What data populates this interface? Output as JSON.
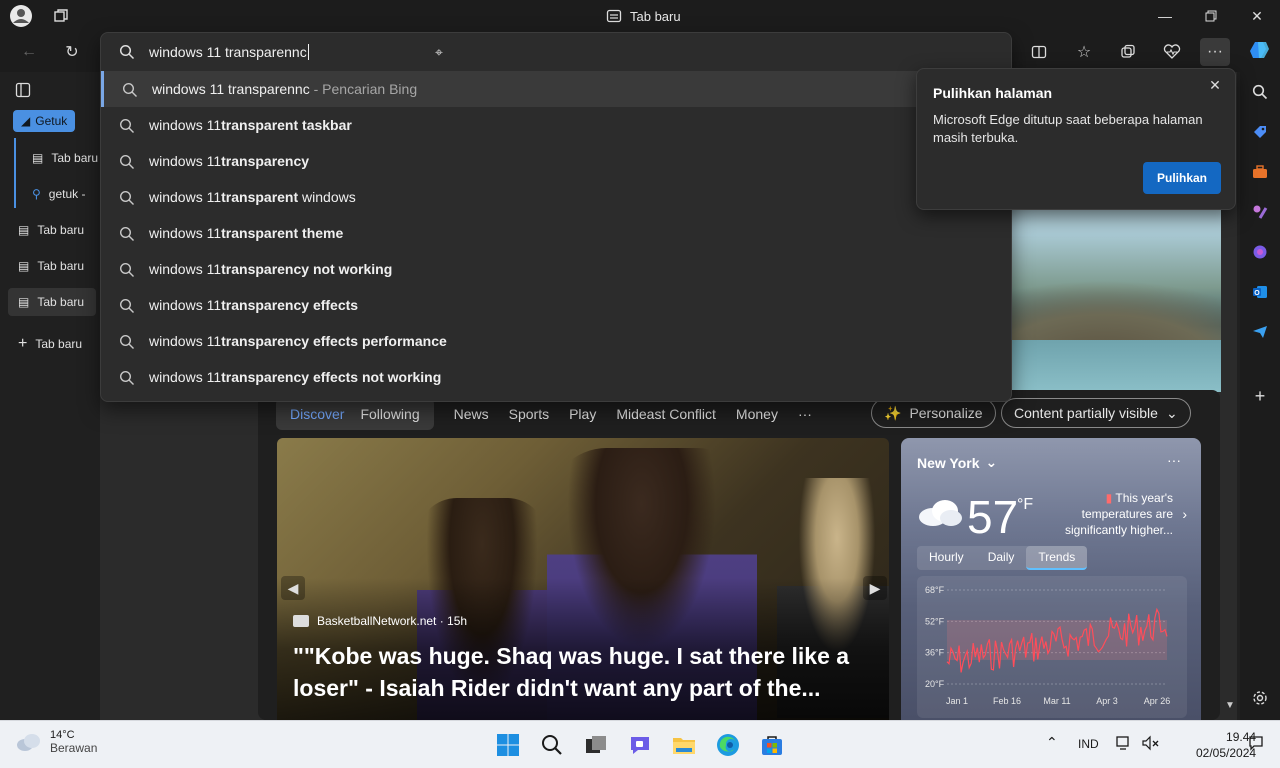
{
  "window": {
    "title": "Tab baru"
  },
  "omnibox": {
    "query": "windows 11 transparennc",
    "suggestions": [
      {
        "prefix": "windows 11 transparennc",
        "bold": "",
        "rest": "",
        "suffix": " - Pencarian Bing"
      },
      {
        "prefix": "windows 11 ",
        "bold": "transparent taskbar",
        "rest": "",
        "suffix": ""
      },
      {
        "prefix": "windows 11 ",
        "bold": "transparency",
        "rest": "",
        "suffix": ""
      },
      {
        "prefix": "windows 11 ",
        "bold": "transparent",
        "rest": " windows",
        "suffix": ""
      },
      {
        "prefix": "windows 11 ",
        "bold": "transparent theme",
        "rest": "",
        "suffix": ""
      },
      {
        "prefix": "windows 11 ",
        "bold": "transparency not working",
        "rest": "",
        "suffix": ""
      },
      {
        "prefix": "windows 11 ",
        "bold": "transparency effects",
        "rest": "",
        "suffix": ""
      },
      {
        "prefix": "windows 11 ",
        "bold": "transparency effects performance",
        "rest": "",
        "suffix": ""
      },
      {
        "prefix": "windows 11 ",
        "bold": "transparency effects not working",
        "rest": "",
        "suffix": ""
      }
    ]
  },
  "vertical_tabs": {
    "group_label": "Getuk",
    "group_items": [
      "Tab baru",
      "getuk -"
    ],
    "tabs": [
      "Tab baru",
      "Tab baru",
      "Tab baru"
    ],
    "new_tab_label": "Tab baru"
  },
  "popup": {
    "title": "Pulihkan halaman",
    "body": "Microsoft Edge ditutup saat beberapa halaman masih terbuka.",
    "button": "Pulihkan"
  },
  "feed": {
    "segment": [
      "Discover",
      "Following"
    ],
    "tabs": [
      "News",
      "Sports",
      "Play",
      "Mideast Conflict",
      "Money",
      "···"
    ],
    "personalize": "Personalize",
    "content_filter": "Content partially visible"
  },
  "news_card": {
    "source": "BasketballNetwork.net · 15h",
    "headline": "\"\"Kobe was huge. Shaq was huge. I sat there like a loser\" - Isaiah Rider didn't want any part of the..."
  },
  "weather": {
    "city": "New York",
    "temp": "57",
    "unit": "°F",
    "note": "This year's temperatures are significantly higher...",
    "tabs": [
      "Hourly",
      "Daily",
      "Trends"
    ],
    "chart_data": {
      "type": "line",
      "y_ticks": [
        "68°F",
        "52°F",
        "36°F",
        "20°F"
      ],
      "x_ticks": [
        "Jan 1",
        "Feb 16",
        "Mar 11",
        "Apr 3",
        "Apr 26"
      ],
      "ylim": [
        20,
        68
      ]
    }
  },
  "taskbar": {
    "weather_temp": "14°C",
    "weather_desc": "Berawan",
    "language": "IND",
    "time": "19.44",
    "date": "02/05/2024"
  },
  "colors": {
    "accent": "#4a90e2",
    "button": "#1468c2"
  }
}
